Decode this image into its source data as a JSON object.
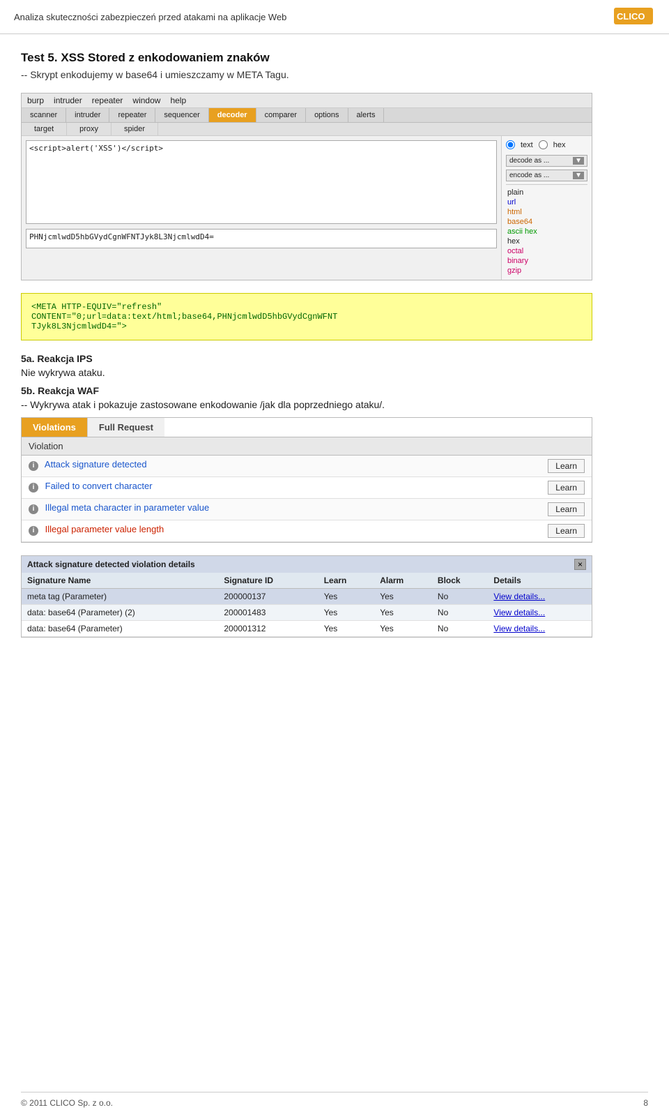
{
  "header": {
    "title": "Analiza skuteczności zabezpieczeń przed atakami na aplikacje Web",
    "logo_text": "CLICO"
  },
  "section_heading": "Test 5. XSS Stored z enkodowaniem znaków",
  "section_sub": "-- Skrypt enkodujemy w base64 i umieszczamy w META Tagu.",
  "burp": {
    "menu_items": [
      "burp",
      "intruder",
      "repeater",
      "window",
      "help"
    ],
    "tabs": [
      "scanner",
      "intruder",
      "repeater",
      "sequencer",
      "decoder",
      "comparer",
      "options",
      "alerts"
    ],
    "active_tab": "decoder",
    "subtabs": [
      "target",
      "proxy",
      "spider"
    ],
    "input_text": "<script>alert('XSS')<\\/script>",
    "output_text": "PHNjcmlwdD5hbGVydCgnWFNTJyk8L3NjcmlwdD4=",
    "radio_text": "text",
    "radio_hex": "hex",
    "decode_label": "decode as ...",
    "encode_label": "encode as ...",
    "menu_options": [
      {
        "label": "plain",
        "class": "plain"
      },
      {
        "label": "url",
        "class": "link-blue"
      },
      {
        "label": "html",
        "class": "link-orange"
      },
      {
        "label": "base64",
        "class": "link-orange"
      },
      {
        "label": "ascii hex",
        "class": "link-green"
      },
      {
        "label": "hex",
        "class": "plain"
      },
      {
        "label": "octal",
        "class": "link-pink"
      },
      {
        "label": "binary",
        "class": "link-pink"
      },
      {
        "label": "gzip",
        "class": "link-pink"
      }
    ]
  },
  "code_block": "<META HTTP-EQUIV=\"refresh\"\nCONTENT=\"0;url=data:text/html;base64,PHNjcmlwdD5hbGVydCgnWFNT\nTJyk8L3NjcmlwdD4=\">",
  "reaction_ips_label": "5a. Reakcja IPS",
  "reaction_ips_text": "Nie wykrywa ataku.",
  "reaction_waf_label": "5b. Reakcja WAF",
  "reaction_waf_text": "-- Wykrywa atak i pokazuje zastosowane enkodowanie /jak dla poprzedniego ataku/.",
  "waf": {
    "tabs": [
      "Violations",
      "Full Request"
    ],
    "active_tab": "Violations",
    "header_col": "Violation",
    "rows": [
      {
        "icon": "i",
        "text": "Attack signature detected",
        "text_class": "violation-text-blue",
        "learn": "Learn"
      },
      {
        "icon": "i",
        "text": "Failed to convert character",
        "text_class": "violation-text-blue",
        "learn": "Learn"
      },
      {
        "icon": "i",
        "text": "Illegal meta character in parameter value",
        "text_class": "violation-text-blue",
        "learn": "Learn"
      },
      {
        "icon": "i",
        "text": "Illegal parameter value length",
        "text_class": "violation-text-red",
        "learn": "Learn"
      }
    ]
  },
  "attack_details": {
    "header": "Attack signature detected violation details",
    "close_btn": "×",
    "columns": [
      "Signature Name",
      "Signature ID",
      "Learn",
      "Alarm",
      "Block",
      "Details"
    ],
    "rows": [
      {
        "name": "meta tag (Parameter)",
        "id": "200000137",
        "learn": "Yes",
        "alarm": "Yes",
        "block": "No",
        "details": "View details..."
      },
      {
        "name": "data: base64 (Parameter) (2)",
        "id": "200001483",
        "learn": "Yes",
        "alarm": "Yes",
        "block": "No",
        "details": "View details..."
      },
      {
        "name": "data: base64 (Parameter)",
        "id": "200001312",
        "learn": "Yes",
        "alarm": "Yes",
        "block": "No",
        "details": "View details..."
      }
    ]
  },
  "footer": {
    "copyright": "© 2011 CLICO Sp. z o.o.",
    "page_number": "8"
  }
}
